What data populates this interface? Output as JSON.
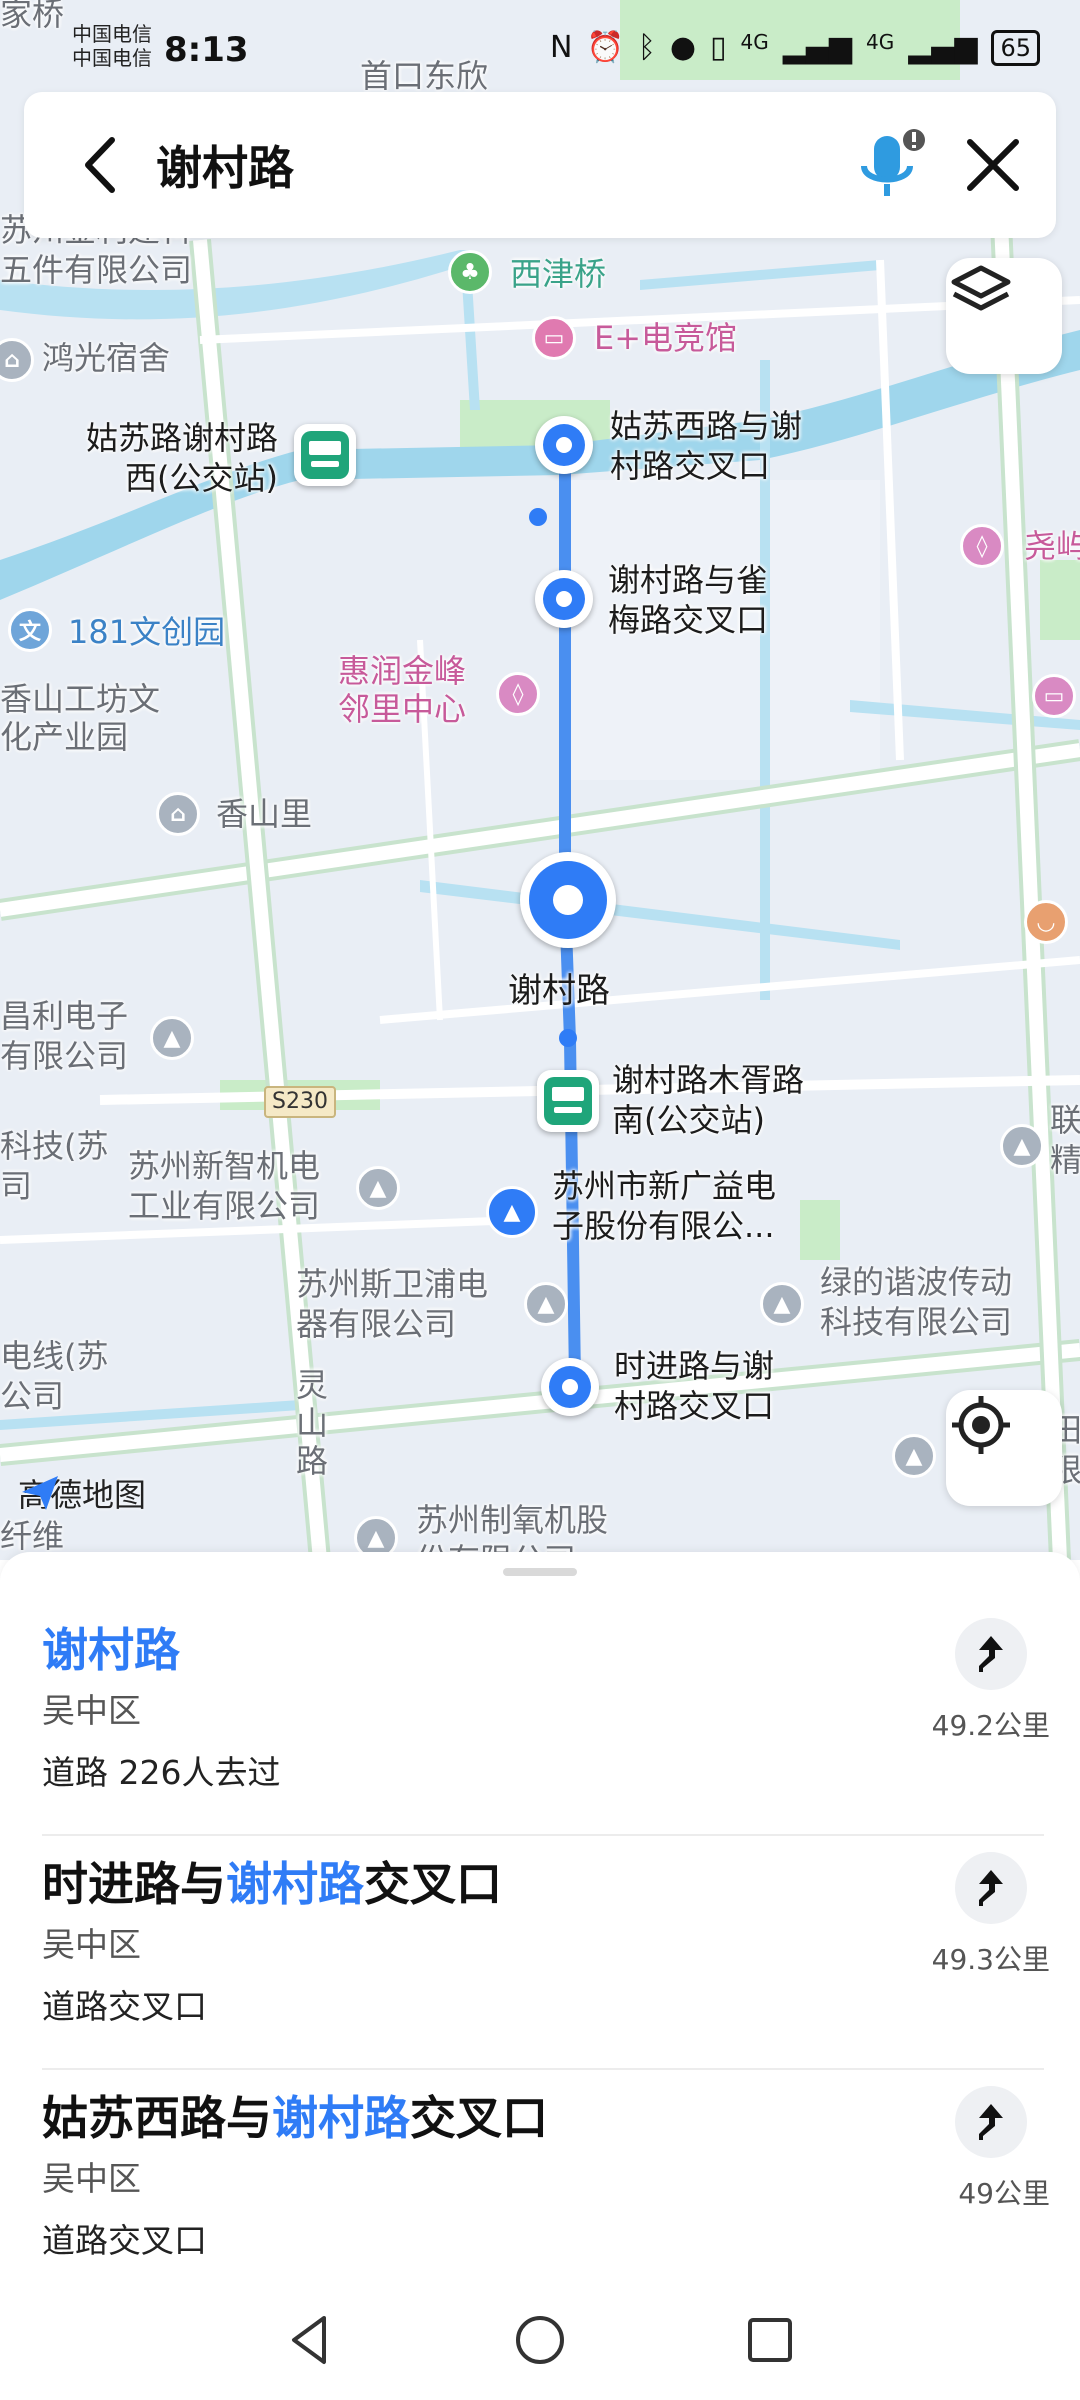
{
  "status_bar": {
    "carrier_1": "中国电信",
    "carrier_2": "中国电信",
    "time": "8:13",
    "battery": "65",
    "signal_1": "4G",
    "signal_2": "4G"
  },
  "search": {
    "query": "谢村路"
  },
  "map": {
    "logo_text": "高德地图",
    "labels": {
      "xijinqiao": "西津桥",
      "esports": "E+电竞馆",
      "hongguang": "鸿光宿舍",
      "gusu_bus": "姑苏路谢村路西(公交站)",
      "gusu_bus_l1": "姑苏路谢村路",
      "gusu_bus_l2": "西(公交站)",
      "gusu_cross_l1": "姑苏西路与谢",
      "gusu_cross_l2": "村路交叉口",
      "queme_l1": "谢村路与雀",
      "queme_l2": "梅路交叉口",
      "wenchuang": "181文创园",
      "huirun_l1": "惠润金峰",
      "huirun_l2": "邻里中心",
      "xiangshan_l1": "香山工坊文",
      "xiangshan_l2": "化产业园",
      "xiangshanli": "香山里",
      "main_pin": "谢村路",
      "changli_l1": "昌利电子",
      "changli_l2": "有限公司",
      "s230": "S230",
      "muxu_l1": "谢村路木胥路",
      "muxu_l2": "南(公交站)",
      "tech_l1": "科技(苏",
      "tech_l2": "司",
      "xinzhi_l1": "苏州新智机电",
      "xinzhi_l2": "工业有限公司",
      "xinguang_l1": "苏州市新广益电",
      "xinguang_l2": "子股份有限公...",
      "siwei_l1": "苏州斯卫浦电",
      "siwei_l2": "器有限公司",
      "lvde_l1": "绿的谐波传动",
      "lvde_l2": "科技有限公司",
      "wire_l1": "电线(苏",
      "wire_l2": "公司",
      "shijin_l1": "时进路与谢",
      "shijin_l2": "村路交叉口",
      "lingshan": "灵山路",
      "zhiyang_l1": "苏州制氧机股",
      "zhiyang_l2": "份有限公司",
      "top_left": "家桥",
      "top_center": "首口东欣",
      "top_left2_l1": "苏州金利建科",
      "top_left2_l2": "五件有限公司",
      "fiber": "纤维",
      "right_edge_1": "尧屿",
      "right_edge_2": "联",
      "right_edge_3": "精",
      "right_edge_4": "田",
      "right_edge_5": "限"
    }
  },
  "results": [
    {
      "title_parts": [
        "",
        "谢村路",
        ""
      ],
      "district": "吴中区",
      "meta": "道路  226人去过",
      "distance": "49.2公里"
    },
    {
      "title_parts": [
        "时进路与",
        "谢村路",
        "交叉口"
      ],
      "district": "吴中区",
      "meta": "道路交叉口",
      "distance": "49.3公里"
    },
    {
      "title_parts": [
        "姑苏西路与",
        "谢村路",
        "交叉口"
      ],
      "district": "吴中区",
      "meta": "道路交叉口",
      "distance": "49公里"
    }
  ],
  "colors": {
    "accent": "#2f7cf6",
    "route": "#4a8ff0",
    "water": "#9fd6ec",
    "green": "#c9ecc8",
    "road": "#ffffff",
    "road_outline": "#c8e3cd"
  }
}
